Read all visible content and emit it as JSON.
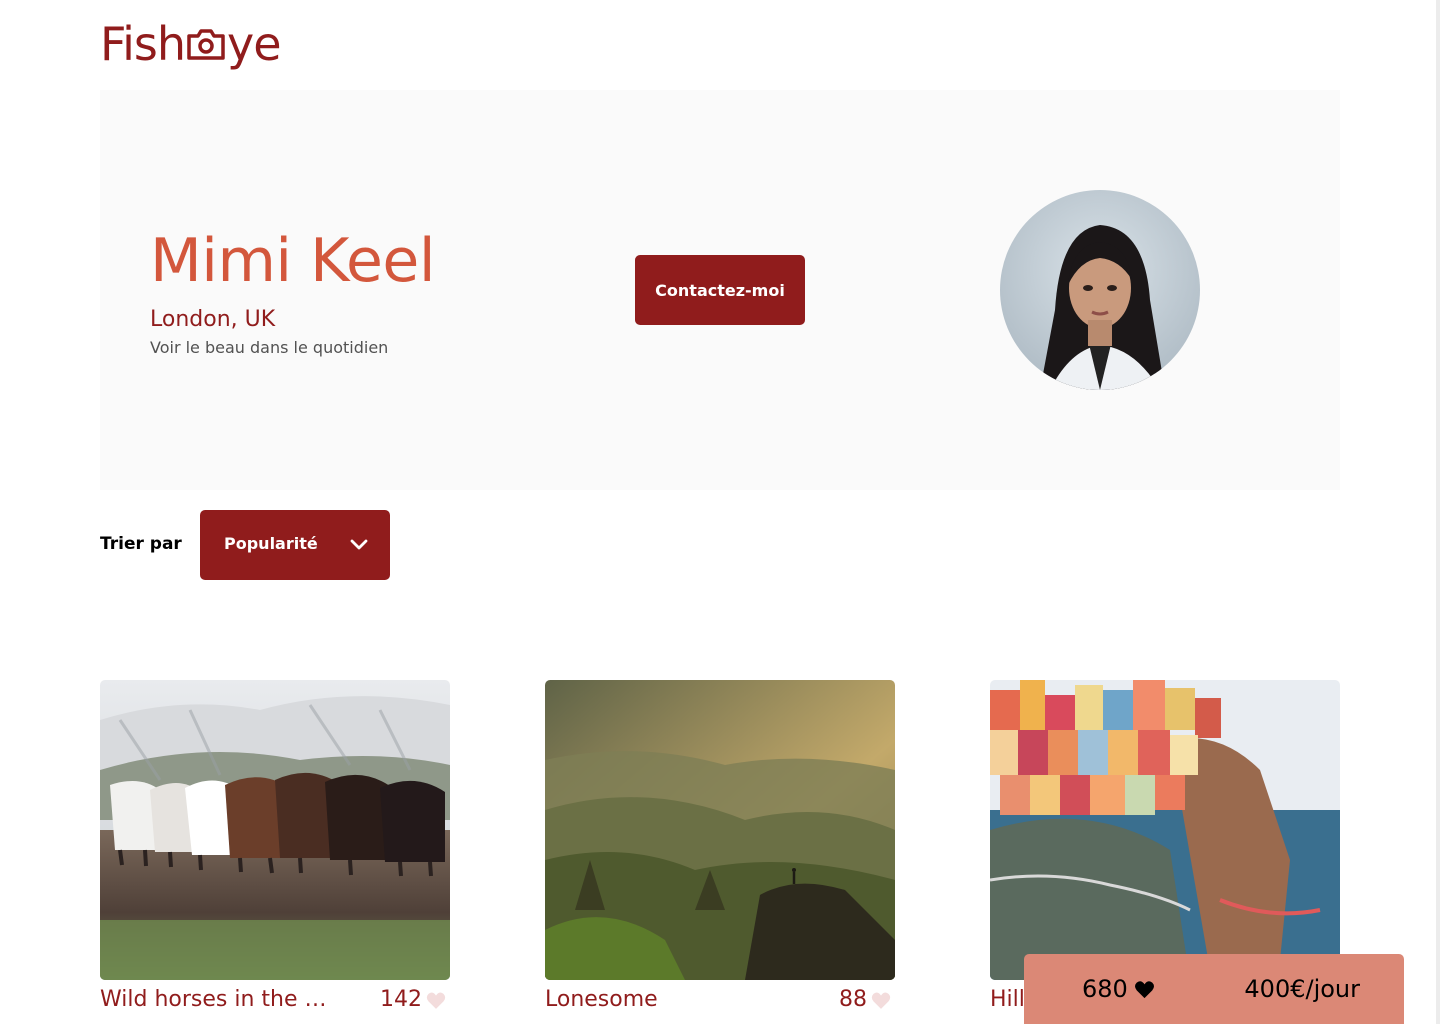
{
  "logo": {
    "text_before": "Fish",
    "text_after": "ye"
  },
  "photographer": {
    "name": "Mimi Keel",
    "location": "London, UK",
    "tagline": "Voir le beau dans le quotidien"
  },
  "contact": {
    "label": "Contactez-moi"
  },
  "sort": {
    "label": "Trier par",
    "selected": "Popularité"
  },
  "media": [
    {
      "title": "Wild horses in the m...",
      "likes": "142",
      "image": "horses"
    },
    {
      "title": "Lonesome",
      "likes": "88",
      "image": "mountains"
    },
    {
      "title": "Hill",
      "likes": "",
      "image": "coastal-village"
    }
  ],
  "stats": {
    "total_likes": "680",
    "price": "400€/jour"
  },
  "colors": {
    "primary": "#901c1c",
    "secondary": "#d3573c",
    "stats_bg": "#db8876",
    "banner_bg": "#fafafa"
  },
  "icons": [
    "camera-icon",
    "chevron-down-icon",
    "heart-icon"
  ]
}
